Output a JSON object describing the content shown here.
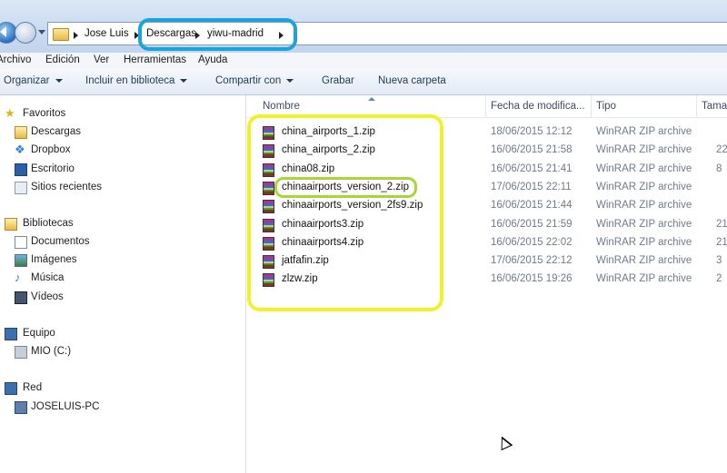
{
  "address": {
    "crumbs": [
      "Jose Luis",
      "Descargas",
      "yiwu-madrid"
    ]
  },
  "menu": [
    "Archivo",
    "Edición",
    "Ver",
    "Herramientas",
    "Ayuda"
  ],
  "toolbar": {
    "organize": "Organizar",
    "library": "Incluir en biblioteca",
    "share": "Compartir con",
    "burn": "Grabar",
    "new_folder": "Nueva carpeta"
  },
  "nav": {
    "favorites": "Favoritos",
    "downloads": "Descargas",
    "dropbox": "Dropbox",
    "desktop": "Escritorio",
    "recent": "Sitios recientes",
    "libraries": "Bibliotecas",
    "documents": "Documentos",
    "images": "Imágenes",
    "music": "Música",
    "videos": "Vídeos",
    "computer": "Equipo",
    "drive": "MIO (C:)",
    "network": "Red",
    "pc": "JOSELUIS-PC"
  },
  "columns": {
    "name": "Nombre",
    "date": "Fecha de modifica...",
    "type": "Tipo",
    "size": "Tama"
  },
  "files": [
    {
      "name": "china_airports_1.zip",
      "date": "18/06/2015 12:12",
      "type": "WinRAR ZIP archive",
      "size": ""
    },
    {
      "name": "china_airports_2.zip",
      "date": "16/06/2015 21:58",
      "type": "WinRAR ZIP archive",
      "size": "22"
    },
    {
      "name": "china08.zip",
      "date": "16/06/2015 21:41",
      "type": "WinRAR ZIP archive",
      "size": "8"
    },
    {
      "name": "chinaairports_version_2.zip",
      "date": "17/06/2015 22:11",
      "type": "WinRAR ZIP archive",
      "size": ""
    },
    {
      "name": "chinaairports_version_2fs9.zip",
      "date": "16/06/2015 21:44",
      "type": "WinRAR ZIP archive",
      "size": ""
    },
    {
      "name": "chinaairports3.zip",
      "date": "16/06/2015 21:59",
      "type": "WinRAR ZIP archive",
      "size": "21"
    },
    {
      "name": "chinaairports4.zip",
      "date": "16/06/2015 22:02",
      "type": "WinRAR ZIP archive",
      "size": "21"
    },
    {
      "name": "jatfafin.zip",
      "date": "17/06/2015 22:12",
      "type": "WinRAR ZIP archive",
      "size": "3"
    },
    {
      "name": "zlzw.zip",
      "date": "16/06/2015 19:26",
      "type": "WinRAR ZIP archive",
      "size": "2"
    }
  ],
  "colors": {
    "highlight_blue": "#1aa3dc",
    "highlight_yellow": "#f2f028",
    "highlight_green": "#a6d63a"
  }
}
